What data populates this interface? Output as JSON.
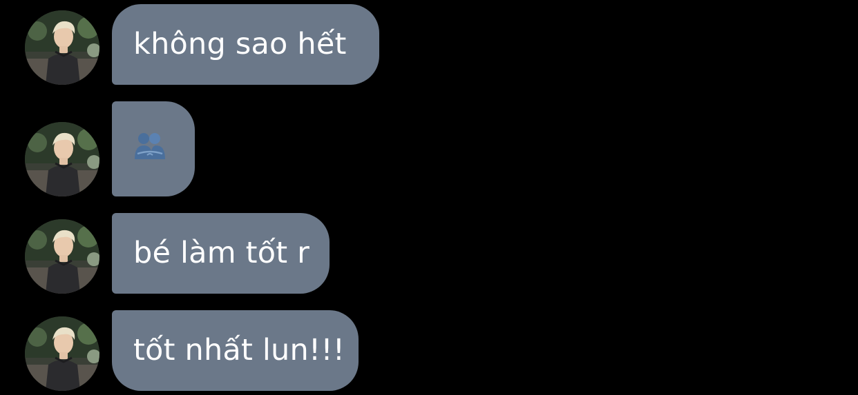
{
  "messages": [
    {
      "type": "text",
      "text": "không sao hết",
      "avatar_icon": "contact-avatar"
    },
    {
      "type": "emoji",
      "emoji_name": "people-hugging-icon",
      "avatar_icon": "contact-avatar"
    },
    {
      "type": "text",
      "text": "bé làm tốt r",
      "avatar_icon": "contact-avatar"
    },
    {
      "type": "text",
      "text": "tốt nhất lun!!!",
      "avatar_icon": "contact-avatar"
    }
  ],
  "colors": {
    "background": "#000000",
    "bubble": "#6b7889",
    "bubble_text": "#ffffff",
    "emoji": "#4a6f9c"
  }
}
